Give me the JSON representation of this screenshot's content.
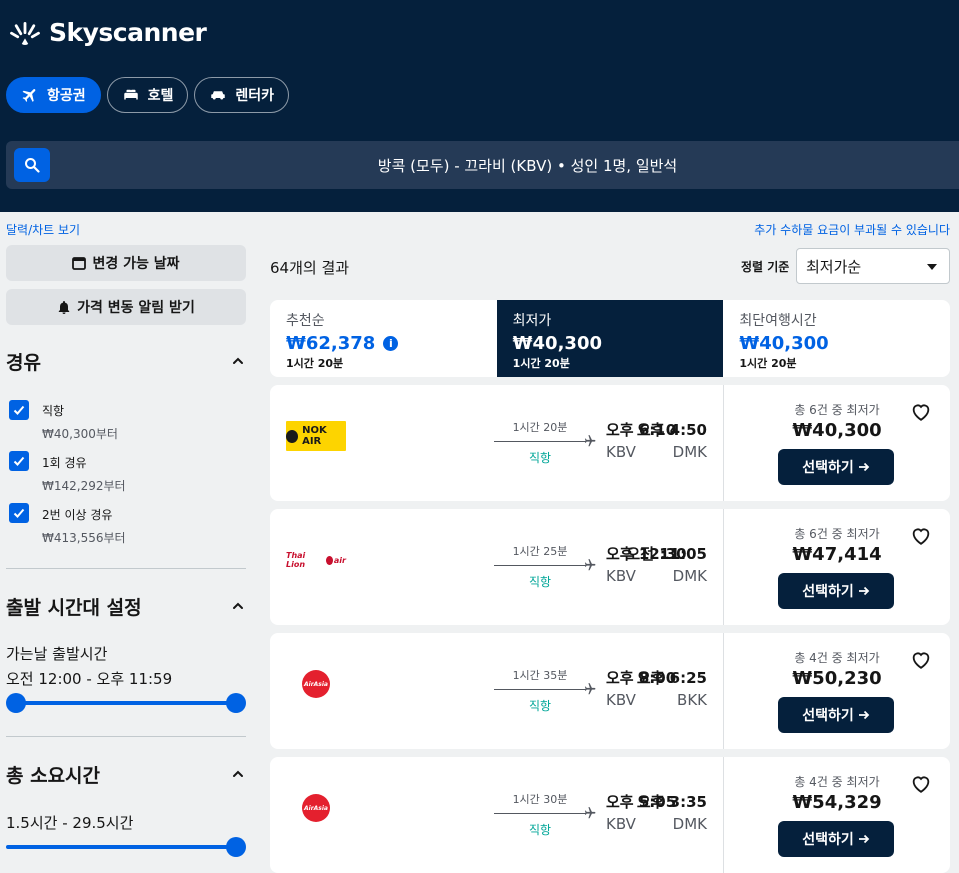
{
  "brand": {
    "name": "Skyscanner"
  },
  "nav": {
    "flights": "항공권",
    "hotels": "호텔",
    "cars": "렌터카"
  },
  "search": {
    "summary": "방콕 (모두) - 끄라비 (KBV)  •  성인 1명, 일반석"
  },
  "links": {
    "calendar": "달력/차트 보기",
    "fees_note": "추가 수하물 요금이 부과될 수 있습니다"
  },
  "sidebar": {
    "flex_dates": "변경 가능 날짜",
    "price_alert": "가격 변동 알림 받기",
    "stops": {
      "title": "경유",
      "options": [
        {
          "label": "직항",
          "price": "₩40,300부터"
        },
        {
          "label": "1회 경유",
          "price": "₩142,292부터"
        },
        {
          "label": "2번 이상 경유",
          "price": "₩413,556부터"
        }
      ]
    },
    "departure": {
      "title": "출발 시간대 설정",
      "label": "가는날 출발시간",
      "range": "오전 12:00 - 오후 11:59",
      "min": 0,
      "max": 1
    },
    "duration": {
      "title": "총 소요시간",
      "range": "1.5시간 - 29.5시간",
      "max": 1
    }
  },
  "results": {
    "count": "64개의 결과",
    "sort_label": "정렬 기준",
    "sort_value": "최저가순",
    "tabs": [
      {
        "name": "추천순",
        "price": "₩62,378",
        "duration": "1시간 20분"
      },
      {
        "name": "최저가",
        "price": "₩40,300",
        "duration": "1시간 20분"
      },
      {
        "name": "최단여행시간",
        "price": "₩40,300",
        "duration": "1시간 20분"
      }
    ],
    "flights": [
      {
        "airline": "Nok Air",
        "logo_text": "NOK AIR",
        "dep_time": "오후 4:50",
        "dep_code": "DMK",
        "duration": "1시간 20분",
        "stops": "직항",
        "arr_time": "오후 6:10",
        "arr_code": "KBV",
        "offers": "총 6건 중 최저가",
        "price": "₩40,300",
        "select": "선택하기"
      },
      {
        "airline": "Thai Lion Air",
        "logo_text": "Thai Lion",
        "logo_text2": "air",
        "dep_time": "오전 11:05",
        "dep_code": "DMK",
        "duration": "1시간 25분",
        "stops": "직항",
        "arr_time": "오후 12:30",
        "arr_code": "KBV",
        "offers": "총 6건 중 최저가",
        "price": "₩47,414",
        "select": "선택하기"
      },
      {
        "airline": "AirAsia",
        "logo_text": "AirAsia",
        "dep_time": "오후 6:25",
        "dep_code": "BKK",
        "duration": "1시간 35분",
        "stops": "직항",
        "arr_time": "오후 8:00",
        "arr_code": "KBV",
        "offers": "총 4건 중 최저가",
        "price": "₩50,230",
        "select": "선택하기"
      },
      {
        "airline": "AirAsia",
        "logo_text": "AirAsia",
        "dep_time": "오후 3:35",
        "dep_code": "DMK",
        "duration": "1시간 30분",
        "stops": "직항",
        "arr_time": "오후 5:05",
        "arr_code": "KBV",
        "offers": "총 4건 중 최저가",
        "price": "₩54,329",
        "select": "선택하기"
      }
    ]
  },
  "colors": {
    "navy": "#05203c",
    "blue": "#0062e3",
    "green": "#00a698"
  }
}
